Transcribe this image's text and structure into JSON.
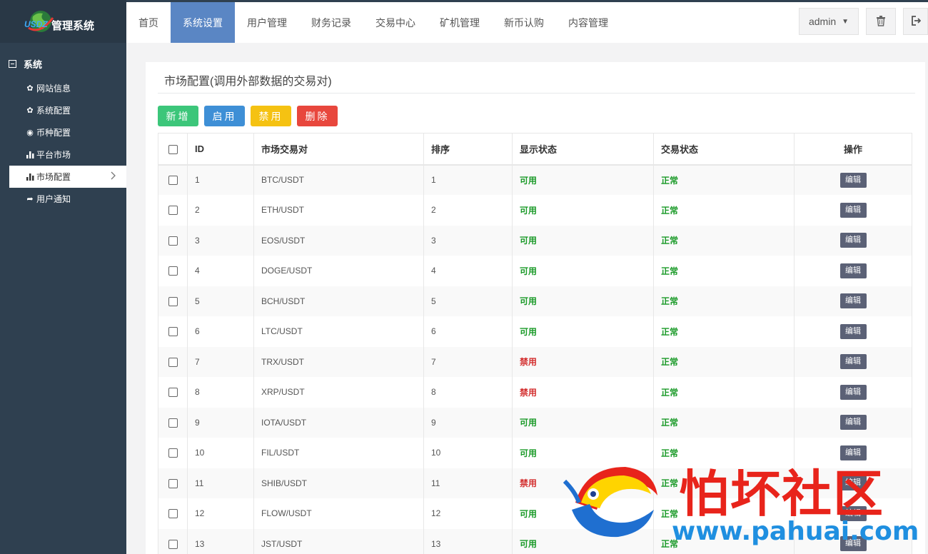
{
  "app": {
    "logo_text": "USDZ",
    "title": "管理系统"
  },
  "sidebar": {
    "group_label": "系统",
    "items": [
      {
        "icon": "gear-icon",
        "glyph": "✿",
        "label": "网站信息"
      },
      {
        "icon": "gear-icon",
        "glyph": "✿",
        "label": "系统配置"
      },
      {
        "icon": "target-icon",
        "glyph": "◉",
        "label": "币种配置"
      },
      {
        "icon": "bar-chart-icon",
        "glyph": "▮",
        "label": "平台市场"
      },
      {
        "icon": "bar-chart-icon",
        "glyph": "▮",
        "label": "市场配置",
        "active": true
      },
      {
        "icon": "share-icon",
        "glyph": "➦",
        "label": "用户通知"
      }
    ]
  },
  "topnav": {
    "tabs": [
      "首页",
      "系统设置",
      "用户管理",
      "财务记录",
      "交易中心",
      "矿机管理",
      "新币认购",
      "内容管理"
    ],
    "active_tab": "系统设置",
    "user_label": "admin"
  },
  "panel": {
    "title": "市场配置(调用外部数据的交易对)",
    "buttons": {
      "add": "新增",
      "enable": "启用",
      "disable": "禁用",
      "delete": "删除"
    },
    "columns": [
      "ID",
      "市场交易对",
      "排序",
      "显示状态",
      "交易状态",
      "操作"
    ],
    "edit_label": "编辑",
    "rows": [
      {
        "id": "1",
        "pair": "BTC/USDT",
        "sort": "1",
        "show": "可用",
        "trade": "正常"
      },
      {
        "id": "2",
        "pair": "ETH/USDT",
        "sort": "2",
        "show": "可用",
        "trade": "正常"
      },
      {
        "id": "3",
        "pair": "EOS/USDT",
        "sort": "3",
        "show": "可用",
        "trade": "正常"
      },
      {
        "id": "4",
        "pair": "DOGE/USDT",
        "sort": "4",
        "show": "可用",
        "trade": "正常"
      },
      {
        "id": "5",
        "pair": "BCH/USDT",
        "sort": "5",
        "show": "可用",
        "trade": "正常"
      },
      {
        "id": "6",
        "pair": "LTC/USDT",
        "sort": "6",
        "show": "可用",
        "trade": "正常"
      },
      {
        "id": "7",
        "pair": "TRX/USDT",
        "sort": "7",
        "show": "禁用",
        "trade": "正常"
      },
      {
        "id": "8",
        "pair": "XRP/USDT",
        "sort": "8",
        "show": "禁用",
        "trade": "正常"
      },
      {
        "id": "9",
        "pair": "IOTA/USDT",
        "sort": "9",
        "show": "可用",
        "trade": "正常"
      },
      {
        "id": "10",
        "pair": "FIL/USDT",
        "sort": "10",
        "show": "可用",
        "trade": "正常"
      },
      {
        "id": "11",
        "pair": "SHIB/USDT",
        "sort": "11",
        "show": "禁用",
        "trade": "正常"
      },
      {
        "id": "12",
        "pair": "FLOW/USDT",
        "sort": "12",
        "show": "可用",
        "trade": "正常"
      },
      {
        "id": "13",
        "pair": "JST/USDT",
        "sort": "13",
        "show": "可用",
        "trade": "正常"
      }
    ]
  },
  "watermark": {
    "text": "怕坏社区",
    "url": "www.pahuai.com"
  },
  "colors": {
    "sidebar_bg": "#2f4050",
    "active_tab": "#5a86c4",
    "status_ok": "#1a9a28",
    "status_disabled": "#d32f2f"
  }
}
